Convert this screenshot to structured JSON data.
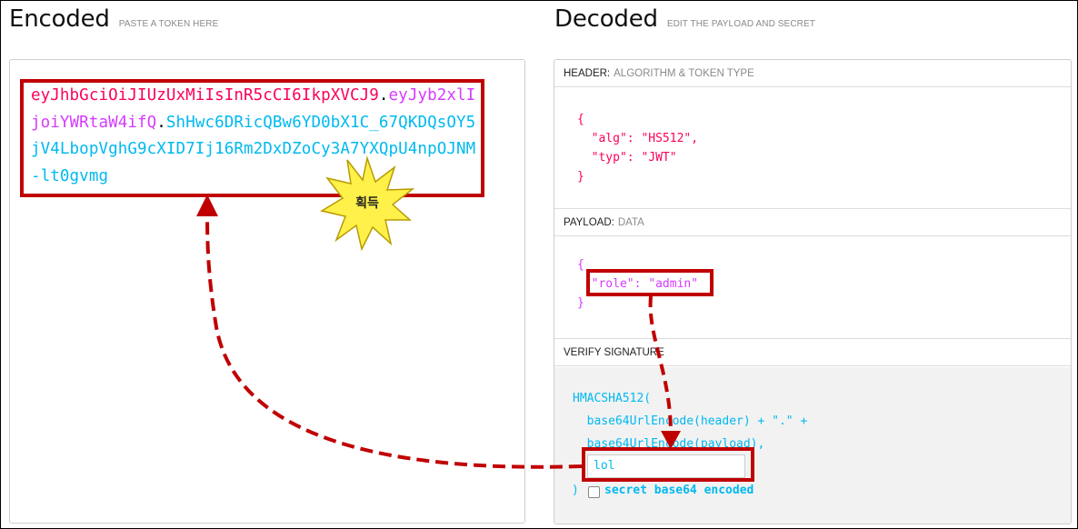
{
  "encoded": {
    "title": "Encoded",
    "subtitle": "PASTE A TOKEN HERE",
    "token_header": "eyJhbGciOiJIUzUxMiIsInR5cCI6IkpXVCJ9",
    "token_payload": "eyJyb2xlIjoiYWRtaW4ifQ",
    "token_signature": "ShHwc6DRicQBw6YD0bX1C_67QKDQsOY5jV4LbopVghG9cXID7Ij16Rm2DxDZoCy3A7YXQpU4npOJNM-lt0gvmg",
    "dot": "."
  },
  "decoded": {
    "title": "Decoded",
    "subtitle": "EDIT THE PAYLOAD AND SECRET",
    "header_section": {
      "label": "HEADER:",
      "sub": "ALGORITHM & TOKEN TYPE"
    },
    "header_json": {
      "open": "{",
      "alg_line": "\"alg\": \"HS512\",",
      "typ_line": "\"typ\": \"JWT\"",
      "close": "}"
    },
    "payload_section": {
      "label": "PAYLOAD:",
      "sub": "DATA"
    },
    "payload_json": {
      "open": "{",
      "role_line": "\"role\": \"admin\"",
      "close": "}"
    },
    "verify_section": {
      "label": "VERIFY SIGNATURE"
    },
    "verify_code": {
      "line1": "HMACSHA512(",
      "line2": "base64UrlEncode(header) + \".\" +",
      "line3": "base64UrlEncode(payload),",
      "close": ")"
    },
    "secret_value": "lol",
    "secret_b64_label": "secret base64 encoded",
    "secret_b64_checked": false
  },
  "annotation": {
    "starburst_label": "획득",
    "highlight_color": "#c00000",
    "star_color": "#fff04a"
  },
  "colors": {
    "jwt_header": "#fb015b",
    "jwt_payload": "#d63aff",
    "jwt_signature": "#00b9f1"
  }
}
